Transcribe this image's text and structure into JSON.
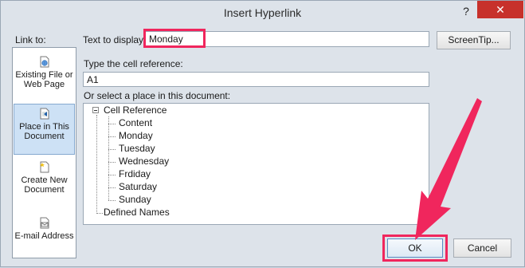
{
  "window": {
    "title": "Insert Hyperlink",
    "help_glyph": "?",
    "close_glyph": "✕"
  },
  "link_to": {
    "label": "Link to:",
    "items": [
      {
        "label": "Existing File or Web Page",
        "icon": "globe-file-icon"
      },
      {
        "label": "Place in This Document",
        "icon": "document-place-icon",
        "selected": true
      },
      {
        "label": "Create New Document",
        "icon": "new-document-icon"
      },
      {
        "label": "E-mail Address",
        "icon": "mail-icon"
      }
    ]
  },
  "text_to_display": {
    "label": "Text to display:",
    "value": "Monday"
  },
  "screentip_label": "ScreenTip...",
  "cell_reference": {
    "label": "Type the cell reference:",
    "value": "A1"
  },
  "place": {
    "label": "Or select a place in this document:",
    "root": "Cell Reference",
    "sheets": [
      "Content",
      "Monday",
      "Tuesday",
      "Wednesday",
      "Frdiday",
      "Saturday",
      "Sunday"
    ],
    "defined_names": "Defined Names"
  },
  "buttons": {
    "ok": "OK",
    "cancel": "Cancel"
  },
  "colors": {
    "highlight": "#f0265d",
    "close_red": "#c7312b",
    "selection_blue": "#cde1f5"
  }
}
